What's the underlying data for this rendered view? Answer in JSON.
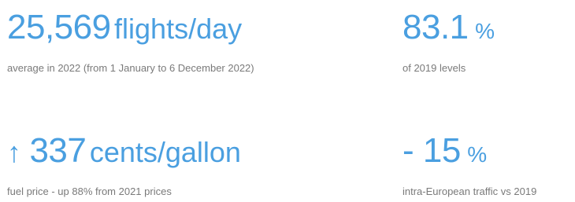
{
  "colors": {
    "accent": "#4a9fe0",
    "caption": "#7a7a7a",
    "background": "#ffffff"
  },
  "stats": [
    {
      "prefix_icon": "",
      "value": "25,569",
      "unit": "flights/day",
      "caption": "average in 2022 (from 1 January to 6 December 2022)"
    },
    {
      "prefix_icon": "",
      "value": "83.1",
      "unit": "%",
      "caption": "of 2019 levels"
    },
    {
      "prefix_icon": "arrow-up-icon",
      "prefix_glyph": "↑",
      "value": "337",
      "unit": "cents/gallon",
      "caption": "fuel price - up 88% from 2021 prices"
    },
    {
      "prefix_icon": "",
      "value": "- 15",
      "unit": "%",
      "caption": "intra-European traffic vs 2019"
    }
  ]
}
